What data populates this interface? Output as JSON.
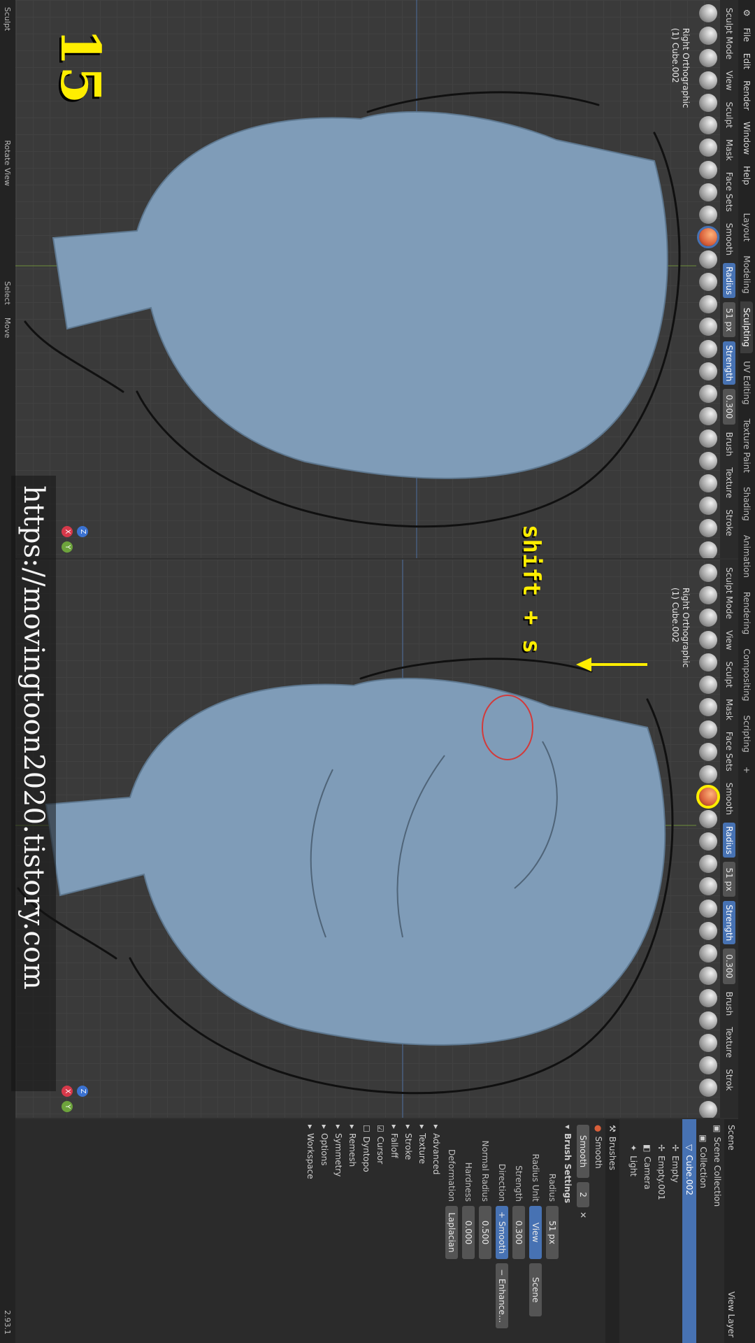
{
  "app": {
    "menus": [
      "File",
      "Edit",
      "Render",
      "Window",
      "Help"
    ],
    "workspaces": [
      "Layout",
      "Modeling",
      "Sculpting",
      "UV Editing",
      "Texture Paint",
      "Shading",
      "Animation",
      "Rendering",
      "Compositing",
      "Scripting"
    ],
    "active_workspace": "Sculpting"
  },
  "viewport_left": {
    "mode": "Sculpt Mode",
    "menu": [
      "View",
      "Sculpt",
      "Mask",
      "Face Sets"
    ],
    "brush_name": "Smooth",
    "radius_label": "Radius",
    "radius_value": "51 px",
    "strength_label": "Strength",
    "strength_value": "0.300",
    "brush_menu": "Brush",
    "texture_menu": "Texture",
    "stroke_menu": "Stroke",
    "view_name": "Right Orthographic",
    "object_name": "(1) Cube.002"
  },
  "viewport_right": {
    "mode": "Sculpt Mode",
    "menu": [
      "View",
      "Sculpt",
      "Mask",
      "Face Sets"
    ],
    "brush_name": "Smooth",
    "radius_label": "Radius",
    "radius_value": "51 px",
    "strength_label": "Strength",
    "strength_value": "0.300",
    "brush_menu": "Brush",
    "texture_menu": "Texture",
    "stroke_menu": "Strok",
    "view_name": "Right Orthographic",
    "object_name": "(1) Cube.002"
  },
  "gizmo": {
    "x": "X",
    "y": "Y",
    "z": "Z"
  },
  "outliner": {
    "header": "Scene",
    "view_layer": "View Layer",
    "root": "Scene Collection",
    "items": [
      "Collection",
      "Cube.002",
      "Empty",
      "Empty.001",
      "Camera",
      "Light"
    ]
  },
  "properties": {
    "brushes_label": "Brushes",
    "brush_name": "Smooth",
    "brush_slot": "Smooth",
    "brush_users": "2",
    "section": "Brush Settings",
    "rows": [
      {
        "label": "Radius",
        "value": "51 px"
      },
      {
        "label": "Radius Unit",
        "value": "View",
        "alt": "Scene"
      },
      {
        "label": "Strength",
        "value": "0.300"
      },
      {
        "label": "Direction",
        "value": "+ Smooth",
        "alt": "− Enhance..."
      },
      {
        "label": "Normal Radius",
        "value": "0.500"
      },
      {
        "label": "Hardness",
        "value": "0.000"
      },
      {
        "label": "Deformation",
        "value": "Laplacian"
      }
    ],
    "subpanels": [
      "Advanced",
      "Texture",
      "Stroke",
      "Falloff",
      "Cursor",
      "Dyntopo",
      "Remesh",
      "Symmetry",
      "Options",
      "Workspace"
    ]
  },
  "statusbar": {
    "items": [
      "Sculpt",
      "Rotate View",
      "Select",
      "Move"
    ],
    "version": "2.93.1"
  },
  "overlay": {
    "step": "15",
    "shortcut": "shift + s",
    "watermark": "https://movingtoon2020.tistory.com"
  },
  "colors": {
    "accent": "#4772b3",
    "annotation": "#ffee00",
    "mesh": "#7f9cb8",
    "brush_circle": "#d23a3a"
  }
}
